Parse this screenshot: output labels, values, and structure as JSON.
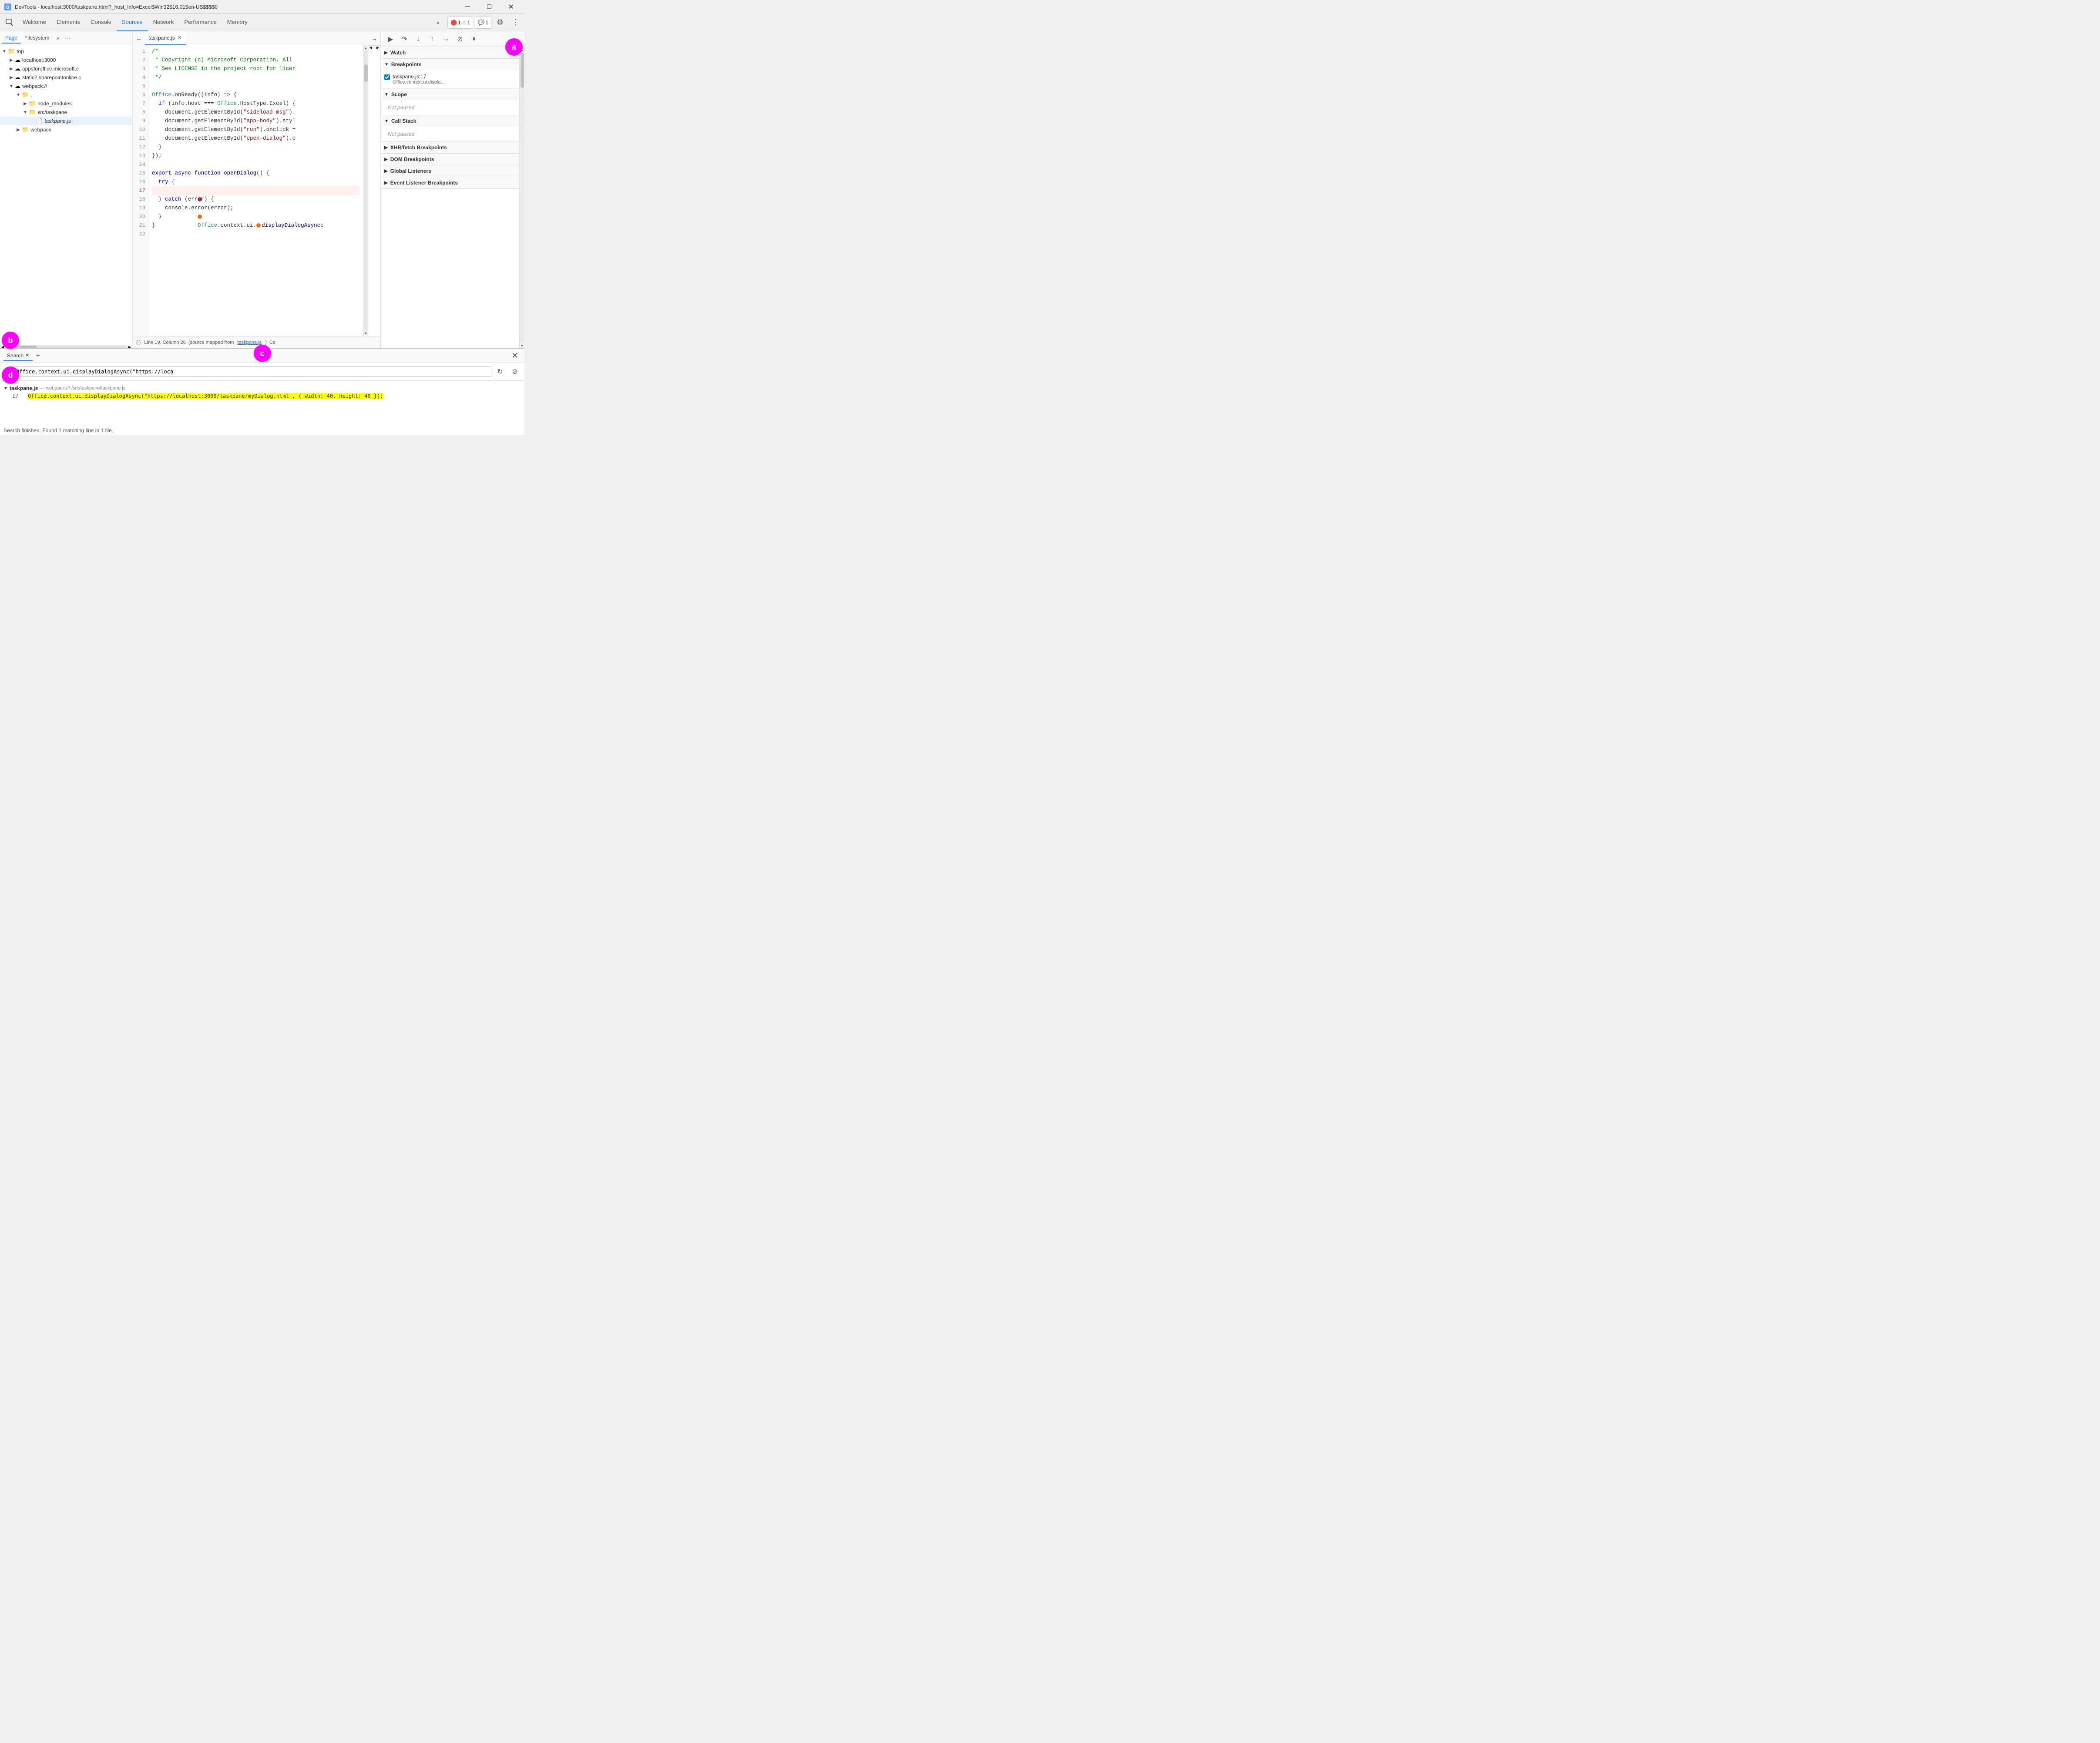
{
  "window": {
    "title": "DevTools - localhost:3000/taskpane.html?_host_Info=Excel$Win32$16.01$en-US$$$$0"
  },
  "nav": {
    "tabs": [
      "Welcome",
      "Elements",
      "Console",
      "Sources",
      "Network",
      "Performance",
      "Memory"
    ],
    "active_tab": "Sources",
    "more_btn": "»",
    "badges": {
      "error": "1",
      "warn": "1",
      "info": "1"
    }
  },
  "left_panel": {
    "tabs": [
      "Page",
      "Filesystem"
    ],
    "more": "»",
    "dots": "⋯",
    "tree": [
      {
        "id": "top",
        "label": "top",
        "level": 0,
        "icon": "folder-open",
        "expanded": true
      },
      {
        "id": "localhost",
        "label": "localhost:3000",
        "level": 1,
        "icon": "cloud",
        "expanded": false
      },
      {
        "id": "appsforoffice",
        "label": "appsforoffice.microsoft.c",
        "level": 1,
        "icon": "cloud",
        "expanded": false
      },
      {
        "id": "static2",
        "label": "static2.sharepointonline.c",
        "level": 1,
        "icon": "cloud",
        "expanded": false
      },
      {
        "id": "webpack",
        "label": "webpack://",
        "level": 1,
        "icon": "cloud",
        "expanded": true
      },
      {
        "id": "dot",
        "label": ".",
        "level": 2,
        "icon": "folder-open",
        "expanded": true
      },
      {
        "id": "node_modules",
        "label": "node_modules",
        "level": 3,
        "icon": "folder",
        "expanded": false
      },
      {
        "id": "src_taskpane",
        "label": "src/taskpane",
        "level": 3,
        "icon": "folder-open",
        "expanded": true
      },
      {
        "id": "taskpane_js",
        "label": "taskpane.js",
        "level": 4,
        "icon": "file",
        "expanded": false,
        "selected": true,
        "italic": true
      },
      {
        "id": "webpack2",
        "label": "webpack",
        "level": 2,
        "icon": "folder",
        "expanded": false
      }
    ]
  },
  "editor": {
    "filename": "taskpane.js",
    "lines": [
      {
        "num": 1,
        "content": "/*",
        "type": "comment"
      },
      {
        "num": 2,
        "content": " * Copyright (c) Microsoft Corporation. All",
        "type": "comment"
      },
      {
        "num": 3,
        "content": " * See LICENSE in the project root for licer",
        "type": "comment"
      },
      {
        "num": 4,
        "content": " */",
        "type": "comment"
      },
      {
        "num": 5,
        "content": "",
        "type": "normal"
      },
      {
        "num": 6,
        "content": "Office.onReady((info) => {",
        "type": "normal"
      },
      {
        "num": 7,
        "content": "  if (info.host === Office.HostType.Excel) {",
        "type": "normal"
      },
      {
        "num": 8,
        "content": "    document.getElementById(\"sideload-msg\").",
        "type": "normal"
      },
      {
        "num": 9,
        "content": "    document.getElementById(\"app-body\").styl",
        "type": "normal"
      },
      {
        "num": 10,
        "content": "    document.getElementById(\"run\").onclick =",
        "type": "normal"
      },
      {
        "num": 11,
        "content": "    document.getElementById(\"open-dialog\").c",
        "type": "normal"
      },
      {
        "num": 12,
        "content": "  }",
        "type": "normal"
      },
      {
        "num": 13,
        "content": "});",
        "type": "normal"
      },
      {
        "num": 14,
        "content": "",
        "type": "normal"
      },
      {
        "num": 15,
        "content": "export async function openDialog() {",
        "type": "normal"
      },
      {
        "num": 16,
        "content": "  try {",
        "type": "normal"
      },
      {
        "num": 17,
        "content": "    Office.context.ui.displayDialogAsync",
        "type": "breakpoint"
      },
      {
        "num": 18,
        "content": "  } catch (error) {",
        "type": "normal"
      },
      {
        "num": 19,
        "content": "    console.error(error);",
        "type": "normal"
      },
      {
        "num": 20,
        "content": "  }",
        "type": "normal"
      },
      {
        "num": 21,
        "content": "}",
        "type": "normal"
      },
      {
        "num": 22,
        "content": "",
        "type": "normal"
      }
    ],
    "status": "Line 19, Column 26  (source mapped from taskpane.js)  Co"
  },
  "right_panel": {
    "sections": {
      "watch": {
        "label": "Watch",
        "expanded": false
      },
      "breakpoints": {
        "label": "Breakpoints",
        "expanded": true,
        "items": [
          {
            "file": "taskpane.js:17",
            "code": "Office.context.ui.displa..."
          }
        ]
      },
      "scope": {
        "label": "Scope",
        "expanded": true,
        "status": "Not paused"
      },
      "call_stack": {
        "label": "Call Stack",
        "expanded": true,
        "status": "Not paused"
      },
      "xhr_fetch": {
        "label": "XHR/fetch Breakpoints",
        "expanded": false
      },
      "dom": {
        "label": "DOM Breakpoints",
        "expanded": false
      },
      "global_listeners": {
        "label": "Global Listeners",
        "expanded": false
      },
      "event_listener": {
        "label": "Event Listener Breakpoints",
        "expanded": false
      }
    }
  },
  "search": {
    "tab_label": "Search",
    "query": "Office.context.ui.displayDialogAsync(\"https://loca",
    "result_file": "taskpane.js",
    "result_path": "— webpack:///./src/taskpane/taskpane.js",
    "result_line_num": "17",
    "result_line_text": "Office.context.ui.displayDialogAsync(\"https://localhost:3000/taskpane/myDialog.html\", { width: 40, height: 40 });",
    "status": "Search finished.  Found 1 matching line in 1 file."
  },
  "annotations": {
    "a": "a",
    "b": "b",
    "c": "c",
    "d": "d"
  },
  "icons": {
    "arrow_right": "▶",
    "arrow_down": "▼",
    "folder_open": "📁",
    "folder": "📁",
    "file": "📄",
    "cloud": "☁",
    "close": "✕",
    "minimize": "─",
    "maximize": "□",
    "gear": "⚙",
    "more_horiz": "⋮",
    "more_vert": "›",
    "back": "←",
    "forward": "→",
    "up": "↑",
    "down": "↓",
    "resume": "▶",
    "step_over": "↷",
    "step_into": "↓",
    "step_out": "↑",
    "deactivate": "⊘",
    "pause_on_exc": "⏸",
    "refresh": "↻",
    "cancel": "⊘",
    "chevron_down": "▾",
    "chevron_right": "▸",
    "add": "+",
    "columns": "⊞"
  }
}
